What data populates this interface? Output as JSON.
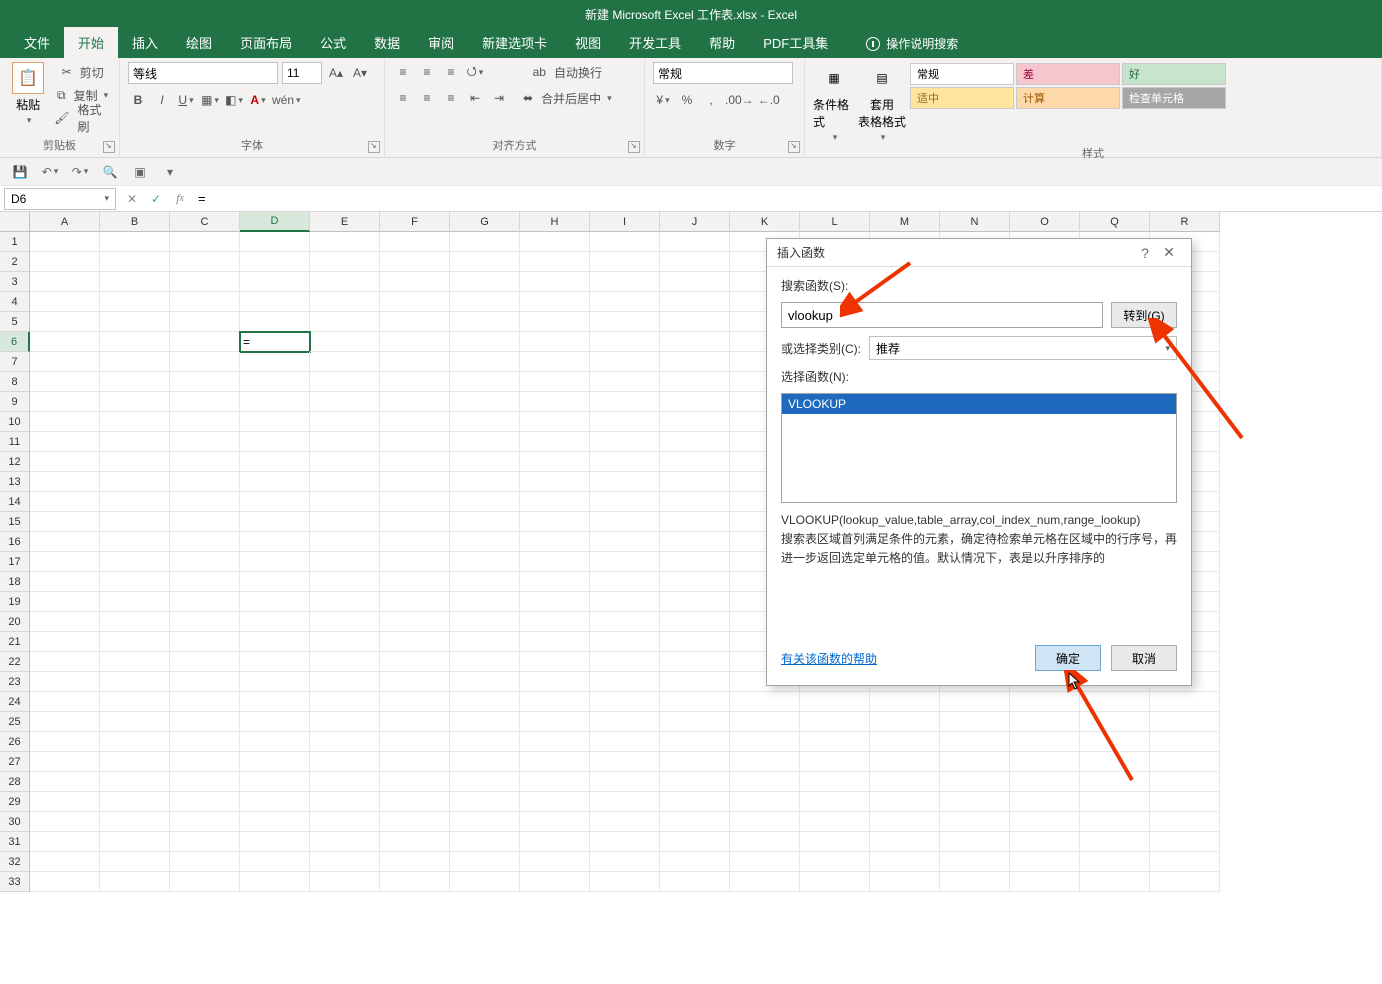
{
  "title": "新建 Microsoft Excel 工作表.xlsx - Excel",
  "tabs": [
    "文件",
    "开始",
    "插入",
    "绘图",
    "页面布局",
    "公式",
    "数据",
    "审阅",
    "新建选项卡",
    "视图",
    "开发工具",
    "帮助",
    "PDF工具集"
  ],
  "active_tab": "开始",
  "tell_me": "操作说明搜索",
  "clipboard": {
    "paste": "粘贴",
    "cut": "剪切",
    "copy": "复制",
    "painter": "格式刷",
    "group": "剪贴板"
  },
  "font": {
    "name": "等线",
    "size": "11",
    "group": "字体"
  },
  "align": {
    "wrap": "自动换行",
    "merge": "合并后居中",
    "group": "对齐方式"
  },
  "number": {
    "format": "常规",
    "group": "数字"
  },
  "styles": {
    "cond": "条件格式",
    "table": "套用\n表格格式",
    "normal": "常规",
    "bad": "差",
    "good": "好",
    "neutral": "适中",
    "calc": "计算",
    "check": "检查单元格",
    "group": "样式"
  },
  "namebox": "D6",
  "formula": "=",
  "active_cell": {
    "col": "D",
    "row": 6,
    "value": "="
  },
  "columns": [
    "A",
    "B",
    "C",
    "D",
    "E",
    "F",
    "G",
    "H",
    "I",
    "J",
    "K",
    "L",
    "M",
    "N",
    "O",
    "Q",
    "R"
  ],
  "row_count": 33,
  "dialog": {
    "title": "插入函数",
    "search_label": "搜索函数(S):",
    "search_value": "vlookup",
    "go_btn": "转到(G)",
    "category_label": "或选择类别(C):",
    "category_value": "推荐",
    "select_label": "选择函数(N):",
    "list": [
      "VLOOKUP"
    ],
    "syntax": "VLOOKUP(lookup_value,table_array,col_index_num,range_lookup)",
    "desc": "搜索表区域首列满足条件的元素，确定待检索单元格在区域中的行序号，再进一步返回选定单元格的值。默认情况下，表是以升序排序的",
    "help_link": "有关该函数的帮助",
    "ok": "确定",
    "cancel": "取消"
  }
}
